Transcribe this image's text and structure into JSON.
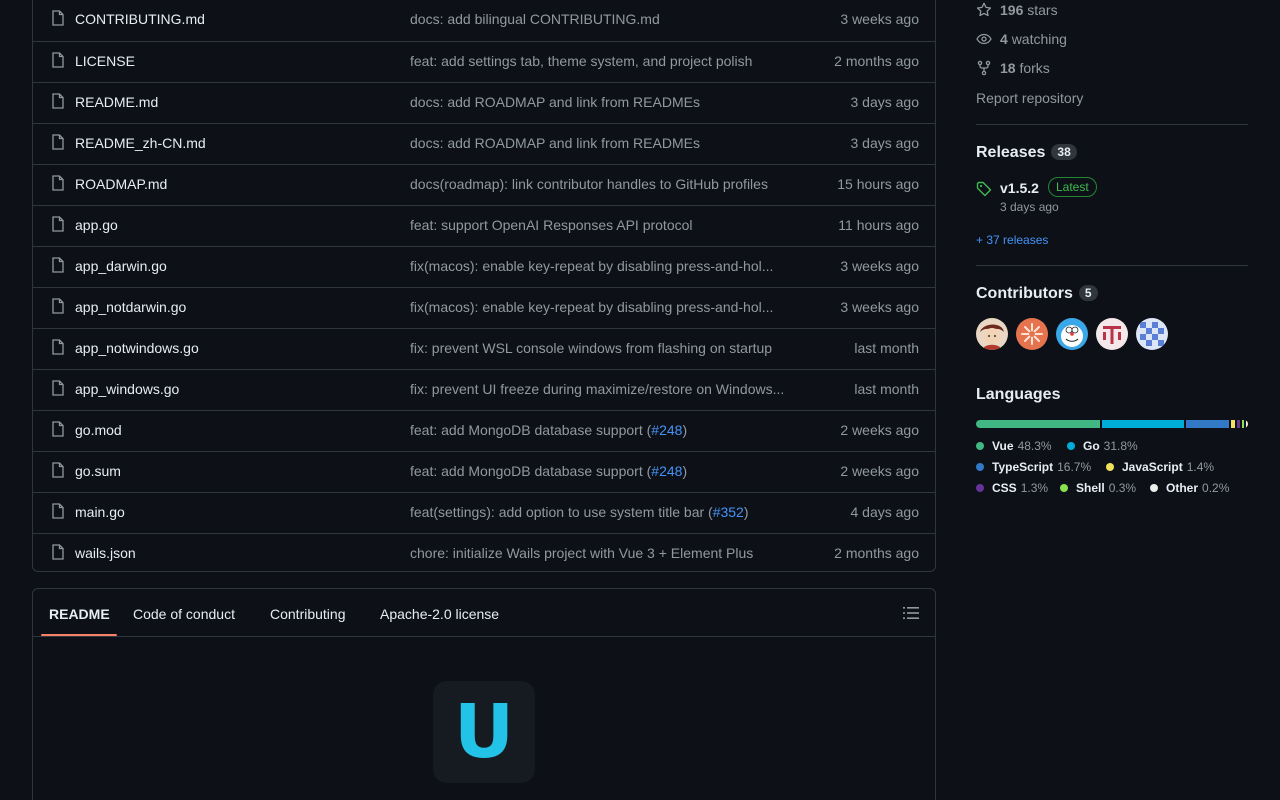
{
  "files": [
    {
      "name": "CONTRIBUTING.md",
      "message": "docs: add bilingual CONTRIBUTING.md",
      "pr": "",
      "suffix": "",
      "time": "3 weeks ago"
    },
    {
      "name": "LICENSE",
      "message": "feat: add settings tab, theme system, and project polish",
      "pr": "",
      "suffix": "",
      "time": "2 months ago"
    },
    {
      "name": "README.md",
      "message": "docs: add ROADMAP and link from READMEs",
      "pr": "",
      "suffix": "",
      "time": "3 days ago"
    },
    {
      "name": "README_zh-CN.md",
      "message": "docs: add ROADMAP and link from READMEs",
      "pr": "",
      "suffix": "",
      "time": "3 days ago"
    },
    {
      "name": "ROADMAP.md",
      "message": "docs(roadmap): link contributor handles to GitHub profiles",
      "pr": "",
      "suffix": "",
      "time": "15 hours ago"
    },
    {
      "name": "app.go",
      "message": "feat: support OpenAI Responses API protocol",
      "pr": "",
      "suffix": "",
      "time": "11 hours ago"
    },
    {
      "name": "app_darwin.go",
      "message": "fix(macos): enable key-repeat by disabling press-and-hol...",
      "pr": "",
      "suffix": "",
      "time": "3 weeks ago"
    },
    {
      "name": "app_notdarwin.go",
      "message": "fix(macos): enable key-repeat by disabling press-and-hol...",
      "pr": "",
      "suffix": "",
      "time": "3 weeks ago"
    },
    {
      "name": "app_notwindows.go",
      "message": "fix: prevent WSL console windows from flashing on startup",
      "pr": "",
      "suffix": "",
      "time": "last month"
    },
    {
      "name": "app_windows.go",
      "message": "fix: prevent UI freeze during maximize/restore on Windows...",
      "pr": "",
      "suffix": "",
      "time": "last month"
    },
    {
      "name": "go.mod",
      "message": "feat: add MongoDB database support (",
      "pr": "#248",
      "suffix": ")",
      "time": "2 weeks ago"
    },
    {
      "name": "go.sum",
      "message": "feat: add MongoDB database support (",
      "pr": "#248",
      "suffix": ")",
      "time": "2 weeks ago"
    },
    {
      "name": "main.go",
      "message": "feat(settings): add option to use system title bar (",
      "pr": "#352",
      "suffix": ")",
      "time": "4 days ago"
    },
    {
      "name": "wails.json",
      "message": "chore: initialize Wails project with Vue 3 + Element Plus",
      "pr": "",
      "suffix": "",
      "time": "2 months ago"
    }
  ],
  "readme": {
    "tabs": [
      "README",
      "Code of conduct",
      "Contributing",
      "Apache-2.0 license"
    ],
    "logo_letter": "U"
  },
  "sidebar": {
    "stars_count": "196",
    "stars_label": "stars",
    "watching_count": "4",
    "watching_label": "watching",
    "forks_count": "18",
    "forks_label": "forks",
    "report": "Report repository",
    "releases_title": "Releases",
    "releases_count": "38",
    "release_version": "v1.5.2",
    "release_badge": "Latest",
    "release_time": "3 days ago",
    "more_releases": "+ 37 releases",
    "contributors_title": "Contributors",
    "contributors_count": "5",
    "languages_title": "Languages",
    "languages": [
      {
        "name": "Vue",
        "percent": "48.3%",
        "value": 48.3,
        "color": "#41b883"
      },
      {
        "name": "Go",
        "percent": "31.8%",
        "value": 31.8,
        "color": "#00add8"
      },
      {
        "name": "TypeScript",
        "percent": "16.7%",
        "value": 16.7,
        "color": "#3178c6"
      },
      {
        "name": "JavaScript",
        "percent": "1.4%",
        "value": 1.4,
        "color": "#f1e05a"
      },
      {
        "name": "CSS",
        "percent": "1.3%",
        "value": 1.3,
        "color": "#663399"
      },
      {
        "name": "Shell",
        "percent": "0.3%",
        "value": 0.3,
        "color": "#89e051"
      },
      {
        "name": "Other",
        "percent": "0.2%",
        "value": 0.2,
        "color": "#ededed"
      }
    ]
  }
}
